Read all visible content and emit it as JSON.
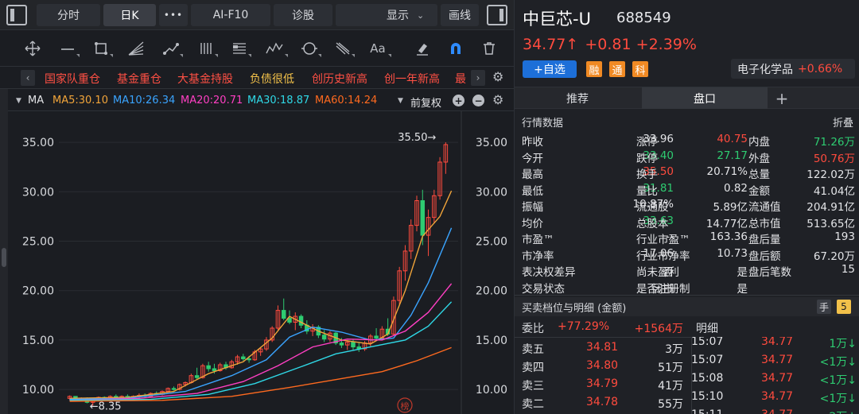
{
  "toolbar": {
    "tab_fenshi": "分时",
    "tab_rik": "日K",
    "more": "•••",
    "tab_f10": "AI-F10",
    "tab_zhengu": "诊股",
    "display": "显示",
    "huaxian": "画线"
  },
  "draw_tools": {
    "text_tool": "Aa"
  },
  "tags": [
    "国家队重仓",
    "基金重仓",
    "大基金持股",
    "负债很低",
    "创历史新高",
    "创一年新高",
    "最"
  ],
  "ma_bar": {
    "label": "MA",
    "ma5": "MA5:30.10",
    "ma10": "MA10:26.34",
    "ma20": "MA20:20.71",
    "ma30": "MA30:18.87",
    "ma60": "MA60:14.24",
    "fuquan": "前复权"
  },
  "colors": {
    "up": "#ff4b3e",
    "down": "#2ecc71",
    "ma5": "#f2a53a",
    "ma10": "#3aa4ff",
    "ma20": "#ff3fc3",
    "ma30": "#2fd8e6",
    "ma60": "#ff6a1f"
  },
  "chart_data": {
    "type": "candlestick",
    "ylim": [
      8,
      37.5
    ],
    "yticks_left": [
      "35.00",
      "30.00",
      "25.00",
      "20.00",
      "15.00",
      "10.00"
    ],
    "yticks_right": [
      "35.00",
      "30.00",
      "25.00",
      "20.00",
      "15.00",
      "10.00"
    ],
    "ytick_values": [
      35,
      30,
      25,
      20,
      15,
      10
    ],
    "high_label": "35.50→",
    "low_label": "←8.35",
    "candles": [
      [
        9.1,
        9.4,
        8.9,
        9.3
      ],
      [
        9.3,
        9.3,
        8.9,
        9.0
      ],
      [
        9.0,
        9.2,
        8.8,
        9.1
      ],
      [
        9.1,
        9.2,
        8.6,
        8.7
      ],
      [
        8.7,
        9.0,
        8.35,
        8.9
      ],
      [
        8.9,
        9.3,
        8.8,
        9.2
      ],
      [
        9.2,
        9.3,
        8.9,
        9.0
      ],
      [
        9.0,
        9.4,
        8.9,
        9.3
      ],
      [
        9.3,
        9.5,
        9.0,
        9.1
      ],
      [
        9.1,
        9.4,
        9.0,
        9.3
      ],
      [
        9.3,
        9.5,
        9.1,
        9.2
      ],
      [
        9.2,
        9.4,
        9.0,
        9.3
      ],
      [
        9.3,
        9.6,
        9.1,
        9.4
      ],
      [
        9.4,
        9.6,
        9.2,
        9.3
      ],
      [
        9.3,
        9.7,
        9.2,
        9.6
      ],
      [
        9.6,
        9.8,
        9.4,
        9.5
      ],
      [
        9.5,
        9.9,
        9.4,
        9.8
      ],
      [
        9.8,
        10.2,
        9.7,
        10.1
      ],
      [
        10.1,
        10.3,
        9.9,
        10.0
      ],
      [
        10.0,
        10.6,
        9.9,
        10.5
      ],
      [
        10.5,
        10.8,
        10.3,
        10.7
      ],
      [
        10.7,
        11.6,
        10.6,
        11.4
      ],
      [
        11.4,
        12.2,
        11.0,
        11.2
      ],
      [
        11.2,
        12.6,
        11.1,
        12.4
      ],
      [
        12.4,
        12.8,
        11.8,
        12.1
      ],
      [
        12.1,
        12.6,
        11.6,
        11.9
      ],
      [
        11.9,
        12.7,
        11.8,
        12.5
      ],
      [
        12.5,
        12.8,
        12.0,
        12.2
      ],
      [
        12.2,
        13.0,
        12.1,
        12.8
      ],
      [
        12.8,
        13.5,
        12.5,
        13.3
      ],
      [
        13.3,
        13.6,
        12.9,
        13.1
      ],
      [
        13.1,
        13.4,
        12.7,
        13.0
      ],
      [
        13.0,
        14.0,
        12.9,
        13.8
      ],
      [
        13.8,
        14.3,
        13.4,
        14.1
      ],
      [
        14.1,
        15.3,
        13.9,
        15.0
      ],
      [
        15.0,
        16.4,
        14.8,
        16.2
      ],
      [
        16.2,
        18.5,
        16.0,
        18.0
      ],
      [
        18.0,
        19.2,
        17.0,
        17.2
      ],
      [
        17.2,
        18.0,
        16.6,
        16.8
      ],
      [
        16.8,
        17.8,
        16.0,
        17.4
      ],
      [
        17.4,
        17.6,
        16.2,
        16.5
      ],
      [
        16.5,
        17.0,
        15.6,
        15.9
      ],
      [
        15.9,
        16.6,
        15.4,
        16.3
      ],
      [
        16.3,
        16.5,
        15.2,
        15.5
      ],
      [
        15.5,
        16.0,
        14.8,
        15.1
      ],
      [
        15.1,
        15.9,
        14.8,
        15.7
      ],
      [
        15.7,
        15.8,
        14.5,
        14.7
      ],
      [
        14.7,
        15.2,
        14.2,
        14.5
      ],
      [
        14.5,
        15.0,
        14.0,
        14.8
      ],
      [
        14.8,
        15.1,
        14.0,
        14.3
      ],
      [
        14.3,
        14.8,
        13.8,
        14.1
      ],
      [
        14.1,
        14.9,
        13.9,
        14.7
      ],
      [
        14.7,
        15.6,
        14.3,
        15.4
      ],
      [
        15.4,
        16.2,
        15.0,
        15.2
      ],
      [
        15.2,
        16.4,
        15.0,
        16.1
      ],
      [
        16.1,
        17.2,
        15.4,
        15.6
      ],
      [
        15.6,
        19.4,
        15.4,
        19.0
      ],
      [
        19.0,
        22.4,
        18.6,
        22.0
      ],
      [
        22.0,
        24.6,
        21.0,
        24.0
      ],
      [
        24.0,
        27.2,
        23.2,
        26.6
      ],
      [
        26.6,
        29.6,
        26.0,
        29.1
      ],
      [
        29.1,
        30.2,
        24.6,
        25.6
      ],
      [
        25.6,
        28.2,
        23.5,
        27.4
      ],
      [
        27.4,
        30.2,
        26.8,
        29.6
      ],
      [
        29.6,
        33.5,
        29.2,
        33.0
      ],
      [
        33.0,
        35.0,
        31.81,
        34.77
      ]
    ],
    "ma_series": [
      {
        "name": "MA5",
        "key": "ma5",
        "points": [
          [
            0,
            9.1
          ],
          [
            10,
            9.2
          ],
          [
            18,
            9.8
          ],
          [
            24,
            11.6
          ],
          [
            30,
            12.8
          ],
          [
            35,
            15.2
          ],
          [
            38,
            17.4
          ],
          [
            43,
            15.9
          ],
          [
            47,
            15.0
          ],
          [
            52,
            14.6
          ],
          [
            55,
            15.6
          ],
          [
            58,
            20.0
          ],
          [
            61,
            25.5
          ],
          [
            64,
            27.5
          ],
          [
            66,
            30.1
          ]
        ]
      },
      {
        "name": "MA10",
        "key": "ma10",
        "points": [
          [
            0,
            9.0
          ],
          [
            10,
            9.1
          ],
          [
            20,
            9.8
          ],
          [
            28,
            11.4
          ],
          [
            34,
            13.0
          ],
          [
            38,
            15.3
          ],
          [
            42,
            16.3
          ],
          [
            47,
            15.8
          ],
          [
            52,
            15.0
          ],
          [
            56,
            15.2
          ],
          [
            59,
            17.5
          ],
          [
            62,
            20.8
          ],
          [
            66,
            26.34
          ]
        ]
      },
      {
        "name": "MA20",
        "key": "ma20",
        "points": [
          [
            0,
            8.9
          ],
          [
            12,
            9.1
          ],
          [
            22,
            9.6
          ],
          [
            30,
            10.8
          ],
          [
            36,
            12.4
          ],
          [
            42,
            14.3
          ],
          [
            48,
            15.1
          ],
          [
            54,
            15.0
          ],
          [
            58,
            15.9
          ],
          [
            62,
            17.8
          ],
          [
            66,
            20.71
          ]
        ]
      },
      {
        "name": "MA30",
        "key": "ma30",
        "points": [
          [
            0,
            8.9
          ],
          [
            14,
            9.0
          ],
          [
            24,
            9.5
          ],
          [
            32,
            10.6
          ],
          [
            40,
            12.3
          ],
          [
            46,
            13.6
          ],
          [
            52,
            14.3
          ],
          [
            58,
            15.0
          ],
          [
            62,
            16.4
          ],
          [
            66,
            18.87
          ]
        ]
      },
      {
        "name": "MA60",
        "key": "ma60",
        "points": [
          [
            0,
            8.8
          ],
          [
            16,
            8.9
          ],
          [
            28,
            9.3
          ],
          [
            38,
            10.2
          ],
          [
            46,
            11.0
          ],
          [
            54,
            11.8
          ],
          [
            60,
            12.9
          ],
          [
            66,
            14.24
          ]
        ]
      }
    ],
    "stamp": "榜"
  },
  "header": {
    "name": "中巨芯-U",
    "code": "688549",
    "price": "34.77↑",
    "change": "+0.81",
    "change_pct": "+2.39%",
    "add_watch": "+自选",
    "badges": [
      "融",
      "通",
      "科"
    ],
    "sector_name": "电子化学品",
    "sector_pct": "+0.66%"
  },
  "tabs": {
    "recommend": "推荐",
    "pankou": "盘口",
    "plus": "+"
  },
  "quote_section": {
    "title": "行情数据",
    "collapse": "折叠",
    "rows": [
      [
        [
          "昨收",
          "33.96",
          "white"
        ],
        [
          "涨停",
          "40.75",
          "red"
        ],
        [
          "内盘",
          "71.26万",
          "green"
        ]
      ],
      [
        [
          "今开",
          "33.40",
          "green"
        ],
        [
          "跌停",
          "27.17",
          "green"
        ],
        [
          "外盘",
          "50.76万",
          "red"
        ]
      ],
      [
        [
          "最高",
          "35.50",
          "red"
        ],
        [
          "换手",
          "20.71%",
          "white"
        ],
        [
          "总量",
          "122.02万",
          "white"
        ]
      ],
      [
        [
          "最低",
          "31.81",
          "green"
        ],
        [
          "量比",
          "0.82",
          "white"
        ],
        [
          "金额",
          "41.04亿",
          "white"
        ]
      ],
      [
        [
          "振幅",
          "10.87%",
          "white"
        ],
        [
          "流通股",
          "5.89亿",
          "white"
        ],
        [
          "流通值",
          "204.91亿",
          "white"
        ]
      ],
      [
        [
          "均价",
          "33.63",
          "green"
        ],
        [
          "总股本",
          "14.77亿",
          "white"
        ],
        [
          "总市值",
          "513.65亿",
          "white"
        ]
      ],
      [
        [
          "市盈™",
          "--",
          "white"
        ],
        [
          "行业市盈™",
          "163.36",
          "white"
        ],
        [
          "盘后量",
          "193",
          "white"
        ]
      ],
      [
        [
          "市净率",
          "17.06",
          "white"
        ],
        [
          "行业市净率",
          "10.73",
          "white"
        ],
        [
          "盘后额",
          "67.20万",
          "white"
        ]
      ],
      [
        [
          "表决权差异",
          "否",
          "white"
        ],
        [
          "尚未盈利",
          "是",
          "white"
        ],
        [
          "盘后笔数",
          "15",
          "white"
        ]
      ],
      [
        [
          "交易状态",
          "闭市",
          "white"
        ],
        [
          "是否注册制",
          "是",
          "white"
        ],
        [
          "",
          "",
          "white"
        ]
      ]
    ]
  },
  "orderbook": {
    "title": "买卖档位与明细 (金额)",
    "hand_icon": "手",
    "five_icon": "5",
    "weibi_label": "委比",
    "weibi_value": "+77.29%",
    "weicha_value": "+1564万",
    "detail_label": "明细",
    "asks": [
      [
        "卖五",
        "34.81",
        "3万"
      ],
      [
        "卖四",
        "34.80",
        "51万"
      ],
      [
        "卖三",
        "34.79",
        "41万"
      ],
      [
        "卖二",
        "34.78",
        "55万"
      ]
    ],
    "trades": [
      [
        "15:07",
        "34.77",
        "1万↓"
      ],
      [
        "15:07",
        "34.77",
        "<1万↓"
      ],
      [
        "15:08",
        "34.77",
        "<1万↓"
      ],
      [
        "15:10",
        "34.77",
        "<1万↓"
      ],
      [
        "15:11",
        "34.77",
        "2万↓"
      ]
    ]
  }
}
